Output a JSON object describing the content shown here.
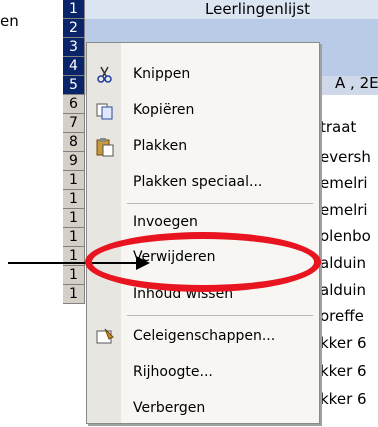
{
  "margin_text": "en",
  "sheet": {
    "rows": [
      "1",
      "2",
      "3",
      "4",
      "5",
      "6",
      "7",
      "8",
      "9",
      "1",
      "1",
      "1",
      "1",
      "1",
      "1",
      "1"
    ],
    "title": "Leerlingenlijst",
    "row3_cell": "A , 2E",
    "row5_cell": "traat",
    "col_cells": [
      "eversh",
      "emelri",
      "emelri",
      "olenbo",
      "alduin",
      "alduin",
      "oreffe",
      "kker 6",
      "kker 6",
      "kker 6"
    ]
  },
  "menu": {
    "items": [
      {
        "label": "Knippen",
        "icon": "scissors-icon"
      },
      {
        "label": "Kopiëren",
        "icon": "copy-icon"
      },
      {
        "label": "Plakken",
        "icon": "paste-icon"
      },
      {
        "label": "Plakken speciaal...",
        "icon": ""
      },
      {
        "label": "Invoegen",
        "icon": ""
      },
      {
        "label": "Verwijderen",
        "icon": ""
      },
      {
        "label": "Inhoud wissen",
        "icon": ""
      },
      {
        "label": "Celeigenschappen...",
        "icon": "cell-properties-icon"
      },
      {
        "label": "Rijhoogte...",
        "icon": ""
      },
      {
        "label": "Verbergen",
        "icon": ""
      }
    ]
  },
  "colors": {
    "highlight": "#e8141f",
    "header_selected": "#0a246a"
  }
}
